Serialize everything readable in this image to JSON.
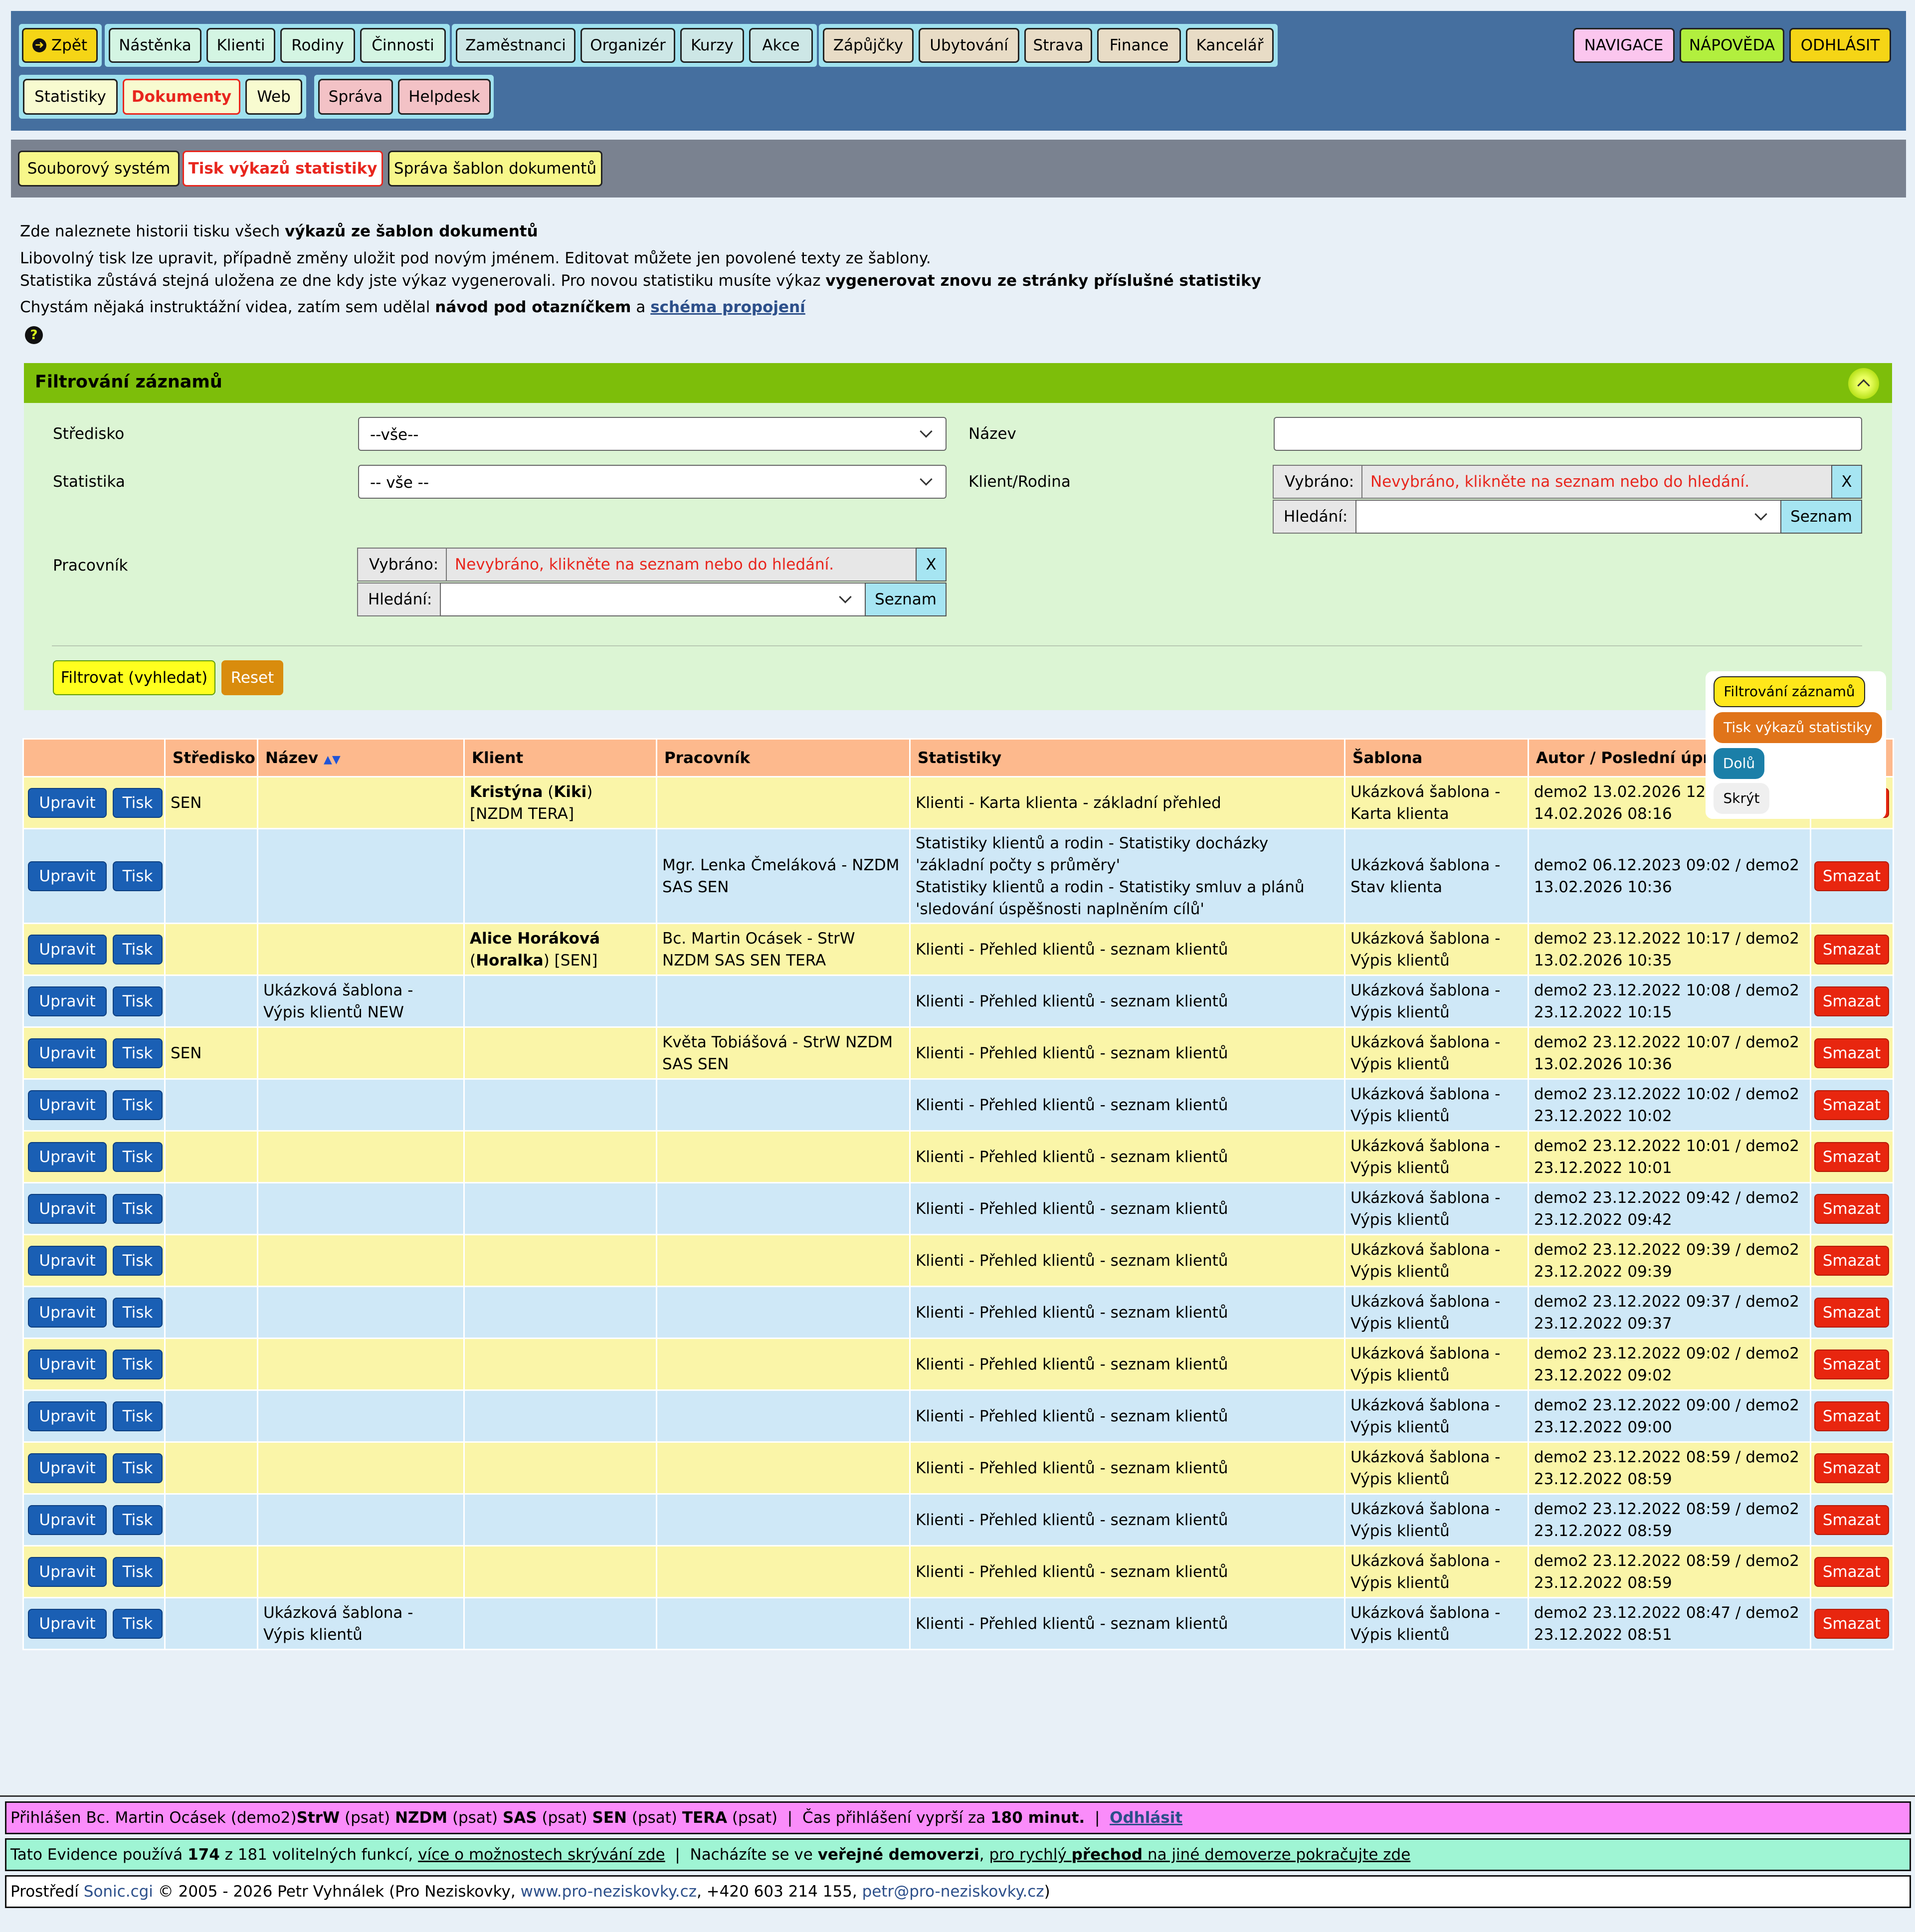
{
  "nav": {
    "back": "Zpět",
    "g1": [
      "Nástěnka",
      "Klienti",
      "Rodiny",
      "Činnosti"
    ],
    "g2": [
      "Zaměstnanci",
      "Organizér",
      "Kurzy",
      "Akce"
    ],
    "g3": [
      "Zápůjčky",
      "Ubytování",
      "Strava",
      "Finance",
      "Kancelář"
    ],
    "navigace": "NAVIGACE",
    "napoveda": "NÁPOVĚDA",
    "odhlasit": "ODHLÁSIT",
    "r2a": [
      "Statistiky",
      "Dokumenty",
      "Web"
    ],
    "r2b": [
      "Správa",
      "Helpdesk"
    ]
  },
  "subnav": [
    "Souborový systém",
    "Tisk výkazů statistiky",
    "Správa šablon dokumentů"
  ],
  "colors": {
    "topbar": "#456f9f",
    "subbar": "#7a8290",
    "filter_header": "#7dbe0a",
    "filter_body": "#dcf5d4",
    "active": "#e8261e"
  },
  "intro": {
    "l1a": "Zde naleznete historii tisku všech ",
    "l1b": "výkazů ze šablon dokumentů",
    ".": ".",
    "l2": "Libovolný tisk lze upravit, případně změny uložit pod novým jménem. Editovat můžete jen povolené texty ze šablony.",
    "l3a": "Statistika zůstává stejná uložena ze dne kdy jste výkaz vygenerovali. Pro novou statistiku musíte výkaz ",
    "l3b": "vygenerovat znovu ze stránky příslušné statistiky",
    "l4a": "Chystám nějaká instruktážní videa, zatím sem udělal ",
    "l4b": "návod pod otazníčkem",
    "l4c": " a ",
    "l4d": "schéma propojení",
    "help_icon": "question-circle-icon"
  },
  "filter": {
    "title": "Filtrování záznamů",
    "stredisko_label": "Středisko",
    "stredisko_value": "--vše--",
    "nazev_label": "Název",
    "statistika_label": "Statistika",
    "statistika_value": "-- vše --",
    "klient_label": "Klient/Rodina",
    "pracovnik_label": "Pracovník",
    "vybrano": "Vybráno:",
    "nevybrano": "Nevybráno, klikněte na seznam nebo do hledání.",
    "x": "X",
    "hledani": "Hledání:",
    "seznam": "Seznam",
    "filtrovat": "Filtrovat (vyhledat)",
    "reset": "Reset"
  },
  "float": {
    "filtr": "Filtrování záznamů",
    "tisk": "Tisk výkazů statistiky",
    "dolu": "Dolů",
    "skryt": "Skrýt"
  },
  "table": {
    "headers": [
      "",
      "Středisko",
      "Název",
      "Klient",
      "Pracovník",
      "Statistiky",
      "Šablona",
      "Autor / Poslední úprava",
      ""
    ],
    "sort_asc": "▲",
    "sort_desc": "▼",
    "upravit": "Upravit",
    "tisk": "Tisk",
    "smazat": "Smazat",
    "rows": [
      {
        "stredisko": "SEN",
        "nazev": "",
        "klient_b1": "Kristýna",
        "klient_t1": " (",
        "klient_b2": "Kiki",
        "klient_t2": ") [NZDM TERA]",
        "pracovnik": "",
        "stat": [
          "Klienti - Karta klienta - základní přehled"
        ],
        "sablona": "Ukázková šablona - Karta klienta",
        "autor": "demo2 13.02.2026 12:09 / demo2 14.02.2026 08:16"
      },
      {
        "stredisko": "",
        "nazev": "",
        "klient_b1": "",
        "klient_t1": "",
        "klient_b2": "",
        "klient_t2": "",
        "pracovnik": "Mgr. Lenka Čmeláková - NZDM SAS SEN",
        "stat": [
          "Statistiky klientů a rodin - Statistiky docházky 'základní počty s průměry'",
          "Statistiky klientů a rodin - Statistiky smluv a plánů 'sledování úspěšnosti naplněním cílů'"
        ],
        "sablona": "Ukázková šablona - Stav klienta",
        "autor": "demo2 06.12.2023 09:02 / demo2 13.02.2026 10:36"
      },
      {
        "stredisko": "",
        "nazev": "",
        "klient_b1": "Alice Horáková",
        "klient_t1": " (",
        "klient_b2": "Horalka",
        "klient_t2": ") [SEN]",
        "pracovnik": "Bc. Martin Ocásek - StrW NZDM SAS SEN TERA",
        "stat": [
          "Klienti - Přehled klientů - seznam klientů"
        ],
        "sablona": "Ukázková šablona - Výpis klientů",
        "autor": "demo2 23.12.2022 10:17 / demo2 13.02.2026 10:35"
      },
      {
        "stredisko": "",
        "nazev": "Ukázková šablona - Výpis klientů NEW",
        "klient_b1": "",
        "klient_t1": "",
        "klient_b2": "",
        "klient_t2": "",
        "pracovnik": "",
        "stat": [
          "Klienti - Přehled klientů - seznam klientů"
        ],
        "sablona": "Ukázková šablona - Výpis klientů",
        "autor": "demo2 23.12.2022 10:08 / demo2 23.12.2022 10:15"
      },
      {
        "stredisko": "SEN",
        "nazev": "",
        "klient_b1": "",
        "klient_t1": "",
        "klient_b2": "",
        "klient_t2": "",
        "pracovnik": "Květa Tobiášová - StrW NZDM SAS SEN",
        "stat": [
          "Klienti - Přehled klientů - seznam klientů"
        ],
        "sablona": "Ukázková šablona - Výpis klientů",
        "autor": "demo2 23.12.2022 10:07 / demo2 13.02.2026 10:36"
      },
      {
        "stredisko": "",
        "nazev": "",
        "klient_b1": "",
        "klient_t1": "",
        "klient_b2": "",
        "klient_t2": "",
        "pracovnik": "",
        "stat": [
          "Klienti - Přehled klientů - seznam klientů"
        ],
        "sablona": "Ukázková šablona - Výpis klientů",
        "autor": "demo2 23.12.2022 10:02 / demo2 23.12.2022 10:02"
      },
      {
        "stredisko": "",
        "nazev": "",
        "klient_b1": "",
        "klient_t1": "",
        "klient_b2": "",
        "klient_t2": "",
        "pracovnik": "",
        "stat": [
          "Klienti - Přehled klientů - seznam klientů"
        ],
        "sablona": "Ukázková šablona - Výpis klientů",
        "autor": "demo2 23.12.2022 10:01 / demo2 23.12.2022 10:01"
      },
      {
        "stredisko": "",
        "nazev": "",
        "klient_b1": "",
        "klient_t1": "",
        "klient_b2": "",
        "klient_t2": "",
        "pracovnik": "",
        "stat": [
          "Klienti - Přehled klientů - seznam klientů"
        ],
        "sablona": "Ukázková šablona - Výpis klientů",
        "autor": "demo2 23.12.2022 09:42 / demo2 23.12.2022 09:42"
      },
      {
        "stredisko": "",
        "nazev": "",
        "klient_b1": "",
        "klient_t1": "",
        "klient_b2": "",
        "klient_t2": "",
        "pracovnik": "",
        "stat": [
          "Klienti - Přehled klientů - seznam klientů"
        ],
        "sablona": "Ukázková šablona - Výpis klientů",
        "autor": "demo2 23.12.2022 09:39 / demo2 23.12.2022 09:39"
      },
      {
        "stredisko": "",
        "nazev": "",
        "klient_b1": "",
        "klient_t1": "",
        "klient_b2": "",
        "klient_t2": "",
        "pracovnik": "",
        "stat": [
          "Klienti - Přehled klientů - seznam klientů"
        ],
        "sablona": "Ukázková šablona - Výpis klientů",
        "autor": "demo2 23.12.2022 09:37 / demo2 23.12.2022 09:37"
      },
      {
        "stredisko": "",
        "nazev": "",
        "klient_b1": "",
        "klient_t1": "",
        "klient_b2": "",
        "klient_t2": "",
        "pracovnik": "",
        "stat": [
          "Klienti - Přehled klientů - seznam klientů"
        ],
        "sablona": "Ukázková šablona - Výpis klientů",
        "autor": "demo2 23.12.2022 09:02 / demo2 23.12.2022 09:02"
      },
      {
        "stredisko": "",
        "nazev": "",
        "klient_b1": "",
        "klient_t1": "",
        "klient_b2": "",
        "klient_t2": "",
        "pracovnik": "",
        "stat": [
          "Klienti - Přehled klientů - seznam klientů"
        ],
        "sablona": "Ukázková šablona - Výpis klientů",
        "autor": "demo2 23.12.2022 09:00 / demo2 23.12.2022 09:00"
      },
      {
        "stredisko": "",
        "nazev": "",
        "klient_b1": "",
        "klient_t1": "",
        "klient_b2": "",
        "klient_t2": "",
        "pracovnik": "",
        "stat": [
          "Klienti - Přehled klientů - seznam klientů"
        ],
        "sablona": "Ukázková šablona - Výpis klientů",
        "autor": "demo2 23.12.2022 08:59 / demo2 23.12.2022 08:59"
      },
      {
        "stredisko": "",
        "nazev": "",
        "klient_b1": "",
        "klient_t1": "",
        "klient_b2": "",
        "klient_t2": "",
        "pracovnik": "",
        "stat": [
          "Klienti - Přehled klientů - seznam klientů"
        ],
        "sablona": "Ukázková šablona - Výpis klientů",
        "autor": "demo2 23.12.2022 08:59 / demo2 23.12.2022 08:59"
      },
      {
        "stredisko": "",
        "nazev": "",
        "klient_b1": "",
        "klient_t1": "",
        "klient_b2": "",
        "klient_t2": "",
        "pracovnik": "",
        "stat": [
          "Klienti - Přehled klientů - seznam klientů"
        ],
        "sablona": "Ukázková šablona - Výpis klientů",
        "autor": "demo2 23.12.2022 08:59 / demo2 23.12.2022 08:59"
      },
      {
        "stredisko": "",
        "nazev": "Ukázková šablona - Výpis klientů",
        "klient_b1": "",
        "klient_t1": "",
        "klient_b2": "",
        "klient_t2": "",
        "pracovnik": "",
        "stat": [
          "Klienti - Přehled klientů - seznam klientů"
        ],
        "sablona": "Ukázková šablona - Výpis klientů",
        "autor": "demo2 23.12.2022 08:47 / demo2 23.12.2022 08:51"
      }
    ]
  },
  "footer": {
    "f1": {
      "a": "Přihlášen Bc. Martin Ocásek (demo2) ",
      "b1": "StrW",
      "c1": " (psat) ",
      "b2": "NZDM",
      "c2": " (psat) ",
      "b3": "SAS",
      "c3": " (psat) ",
      "b4": "SEN",
      "c4": " (psat) ",
      "b5": "TERA",
      "c5": " (psat)  |  Čas přihlášení vyprší za ",
      "b6": "180 minut.",
      "c6": "  |  ",
      "link": "Odhlásit"
    },
    "f2": {
      "a": "Tato Evidence používá ",
      "b1": "174",
      "c1": " z 181 volitelných funkcí, ",
      "u1": "více o možnostech skrývání zde",
      "c2": "  |  Nacházíte se ve ",
      "b2": "veřejné demoverzi",
      ",": ", ",
      "u2a": "pro rychlý ",
      "u2b": "přechod",
      "u2c": " na jiné demoverze pokračujte zde"
    },
    "f3": {
      "a": "Prostředí ",
      "s": "Sonic.cgi",
      "b": " © 2005 - 2026 Petr Vyhnálek (Pro Neziskovky, ",
      "w": "www.pro-neziskovky.cz",
      "c": ", +420 603 214 155, ",
      "e": "petr@pro-neziskovky.cz",
      "d": ")"
    }
  }
}
